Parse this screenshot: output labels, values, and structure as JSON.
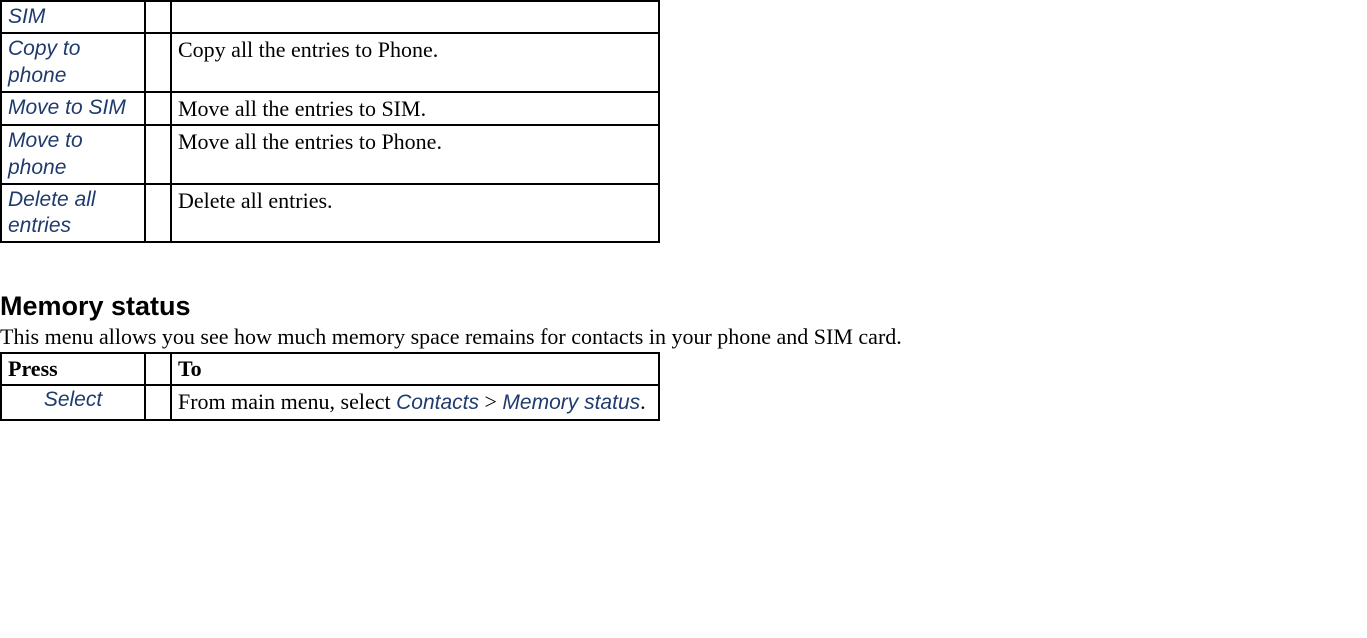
{
  "options_table": {
    "rows": [
      {
        "label": "SIM",
        "desc": ""
      },
      {
        "label": "Copy to phone",
        "desc": "Copy all the entries to Phone."
      },
      {
        "label": "Move to SIM",
        "desc": "Move all the entries to SIM."
      },
      {
        "label": "Move to phone",
        "desc": "Move all the entries to Phone."
      },
      {
        "label": "Delete all entries",
        "desc": "Delete all entries."
      }
    ]
  },
  "section": {
    "heading": "Memory status",
    "paragraph": "This menu allows you see how much memory space remains for contacts in your phone and SIM card."
  },
  "press_table": {
    "headers": {
      "press": "Press",
      "to": "To"
    },
    "row": {
      "press": "Select",
      "to_prefix": "From main menu, select ",
      "to_path1": "Contacts",
      "to_sep": " > ",
      "to_path2": "Memory status",
      "to_suffix": "."
    }
  }
}
